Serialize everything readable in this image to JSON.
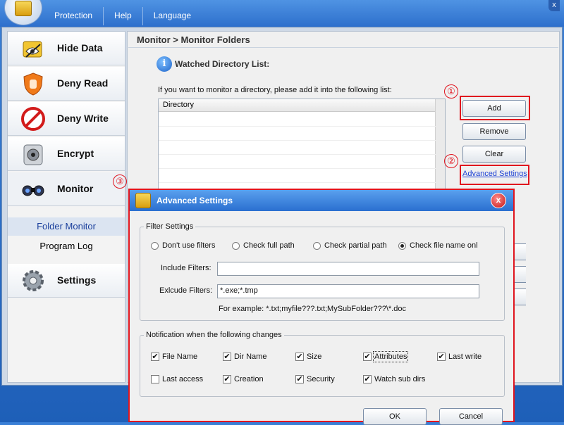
{
  "menu": [
    "Protection",
    "Help",
    "Language"
  ],
  "window": {
    "close_glyph": "x"
  },
  "sidebar": {
    "items": [
      {
        "label": "Hide Data",
        "icon": "hide-data-icon"
      },
      {
        "label": "Deny Read",
        "icon": "shield-hand-icon"
      },
      {
        "label": "Deny Write",
        "icon": "no-entry-icon"
      },
      {
        "label": "Encrypt",
        "icon": "vault-lock-icon"
      },
      {
        "label": "Monitor",
        "icon": "binoculars-icon"
      },
      {
        "label": "Settings",
        "icon": "gear-icon"
      }
    ],
    "subitems": [
      {
        "label": "Folder Monitor",
        "selected": true
      },
      {
        "label": "Program Log",
        "selected": false
      }
    ]
  },
  "breadcrumb": "Monitor > Monitor Folders",
  "watched": {
    "title": "Watched Directory List:",
    "instruction": "If you want to monitor a directory, please add it into the following list:",
    "column": "Directory"
  },
  "buttons": {
    "add": "Add",
    "remove": "Remove",
    "clear": "Clear"
  },
  "advanced_link": "Advanced Settings",
  "callouts": [
    "①",
    "②",
    "③"
  ],
  "dialog": {
    "title": "Advanced Settings",
    "close_glyph": "x",
    "filter_legend": "Filter Settings",
    "radios": [
      {
        "label": "Don't use filters",
        "checked": false
      },
      {
        "label": "Check full path",
        "checked": false
      },
      {
        "label": "Check partial path",
        "checked": false
      },
      {
        "label": "Check file name onl",
        "checked": true
      }
    ],
    "include_label": "Include Filters:",
    "include_value": "",
    "exclude_label": "Exlcude Filters:",
    "exclude_value": "*.exe;*.tmp",
    "example": "For example: *.txt;myfile???.txt;MySubFolder???\\*.doc",
    "notify_legend": "Notification when the following changes",
    "checks_row1": [
      {
        "label": "File Name",
        "checked": true
      },
      {
        "label": "Dir Name",
        "checked": true
      },
      {
        "label": "Size",
        "checked": true
      },
      {
        "label": "Attributes",
        "checked": true
      },
      {
        "label": "Last write",
        "checked": true
      }
    ],
    "checks_row2": [
      {
        "label": "Last access",
        "checked": false
      },
      {
        "label": "Creation",
        "checked": true
      },
      {
        "label": "Security",
        "checked": true
      },
      {
        "label": "Watch sub dirs",
        "checked": true
      }
    ],
    "ok": "OK",
    "cancel": "Cancel"
  },
  "colors": {
    "accent": "#2a6fd0",
    "highlight": "#e0141e",
    "link": "#1a3fd4"
  }
}
